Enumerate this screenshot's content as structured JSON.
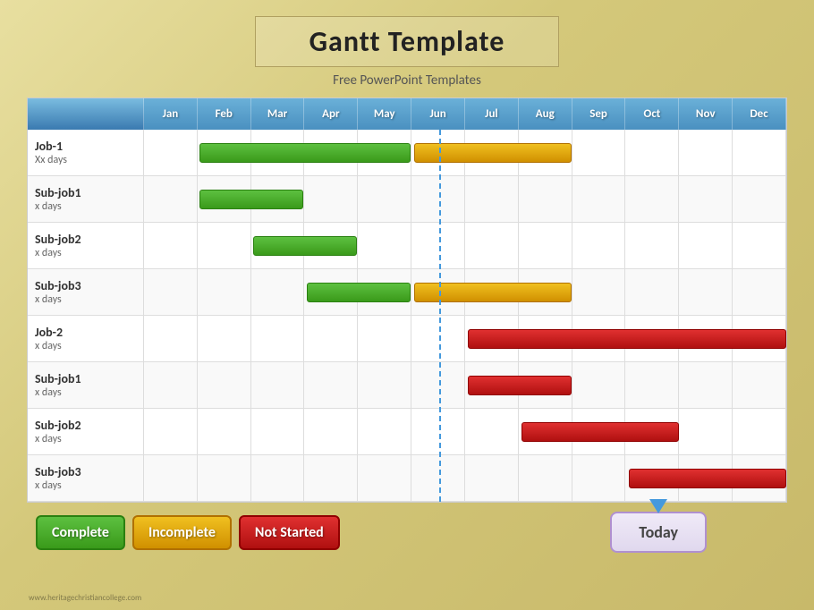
{
  "title": "Gantt Template",
  "subtitle": "Free PowerPoint Templates",
  "months": [
    "Jan",
    "Feb",
    "Mar",
    "Apr",
    "May",
    "Jun",
    "Jul",
    "Aug",
    "Sep",
    "Oct",
    "Nov",
    "Dec"
  ],
  "rows": [
    {
      "name": "Job-1",
      "days": "Xx days",
      "bars": [
        {
          "type": "green",
          "colStart": 2,
          "colEnd": 5,
          "label": "complete"
        },
        {
          "type": "yellow",
          "colStart": 6,
          "colEnd": 8,
          "label": "incomplete"
        }
      ]
    },
    {
      "name": "Sub-job1",
      "days": "x days",
      "bars": [
        {
          "type": "green",
          "colStart": 2,
          "colEnd": 3,
          "label": "complete"
        }
      ]
    },
    {
      "name": "Sub-job2",
      "days": "x days",
      "bars": [
        {
          "type": "green",
          "colStart": 3,
          "colEnd": 4,
          "label": "complete"
        }
      ]
    },
    {
      "name": "Sub-job3",
      "days": "x days",
      "bars": [
        {
          "type": "green",
          "colStart": 4,
          "colEnd": 5,
          "label": "complete"
        },
        {
          "type": "yellow",
          "colStart": 6,
          "colEnd": 8,
          "label": "incomplete"
        }
      ]
    },
    {
      "name": "Job-2",
      "days": "x days",
      "bars": [
        {
          "type": "red",
          "colStart": 7,
          "colEnd": 12,
          "label": "not-started"
        }
      ]
    },
    {
      "name": "Sub-job1",
      "days": "x days",
      "bars": [
        {
          "type": "red",
          "colStart": 7,
          "colEnd": 8,
          "label": "not-started"
        }
      ]
    },
    {
      "name": "Sub-job2",
      "days": "x days",
      "bars": [
        {
          "type": "red",
          "colStart": 8,
          "colEnd": 10,
          "label": "not-started"
        }
      ]
    },
    {
      "name": "Sub-job3",
      "days": "x days",
      "bars": [
        {
          "type": "red",
          "colStart": 10,
          "colEnd": 12,
          "label": "not-started"
        }
      ]
    }
  ],
  "legend": {
    "complete": "Complete",
    "incomplete": "Incomplete",
    "not_started": "Not Started",
    "today": "Today"
  },
  "watermark": "www.heritagechristiancollege.com",
  "today_col": 5.5
}
